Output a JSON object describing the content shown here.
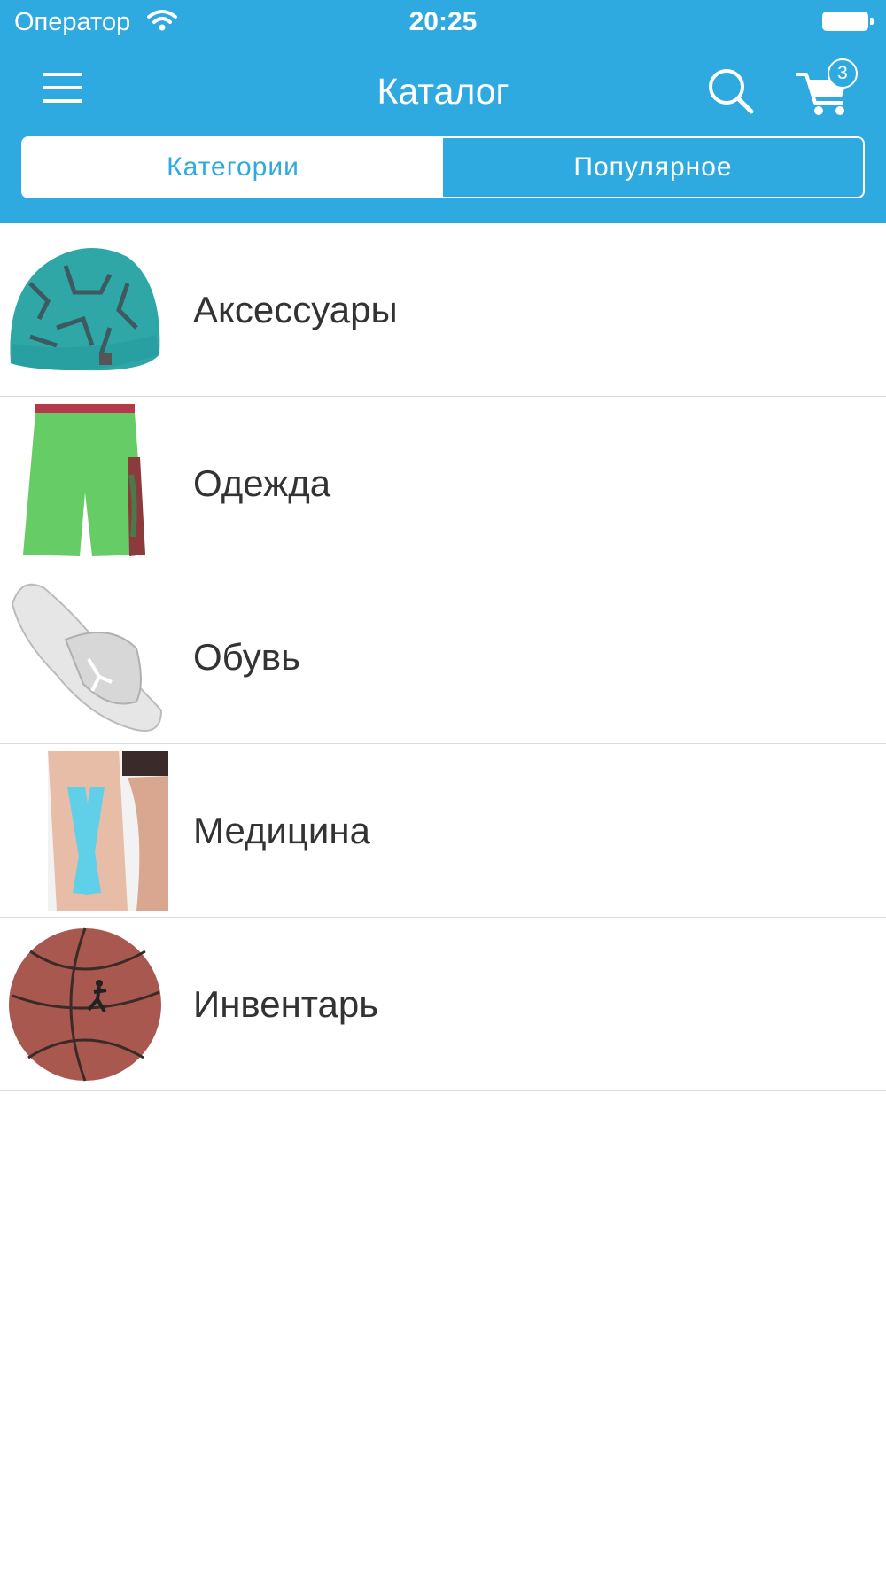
{
  "status_bar": {
    "carrier": "Оператор",
    "time": "20:25"
  },
  "nav_bar": {
    "title": "Каталог",
    "cart_count": "3"
  },
  "tabs": [
    {
      "label": "Категории",
      "active": true
    },
    {
      "label": "Популярное",
      "active": false
    }
  ],
  "categories": [
    {
      "label": "Аксессуары",
      "icon": "beanie-hat-image"
    },
    {
      "label": "Одежда",
      "icon": "shorts-image"
    },
    {
      "label": "Обувь",
      "icon": "slide-sandal-image"
    },
    {
      "label": "Медицина",
      "icon": "kinesio-tape-knee-image"
    },
    {
      "label": "Инвентарь",
      "icon": "basketball-image"
    }
  ],
  "colors": {
    "accent": "#2eaae1",
    "text": "#333333",
    "divider": "#dcdcdc"
  }
}
